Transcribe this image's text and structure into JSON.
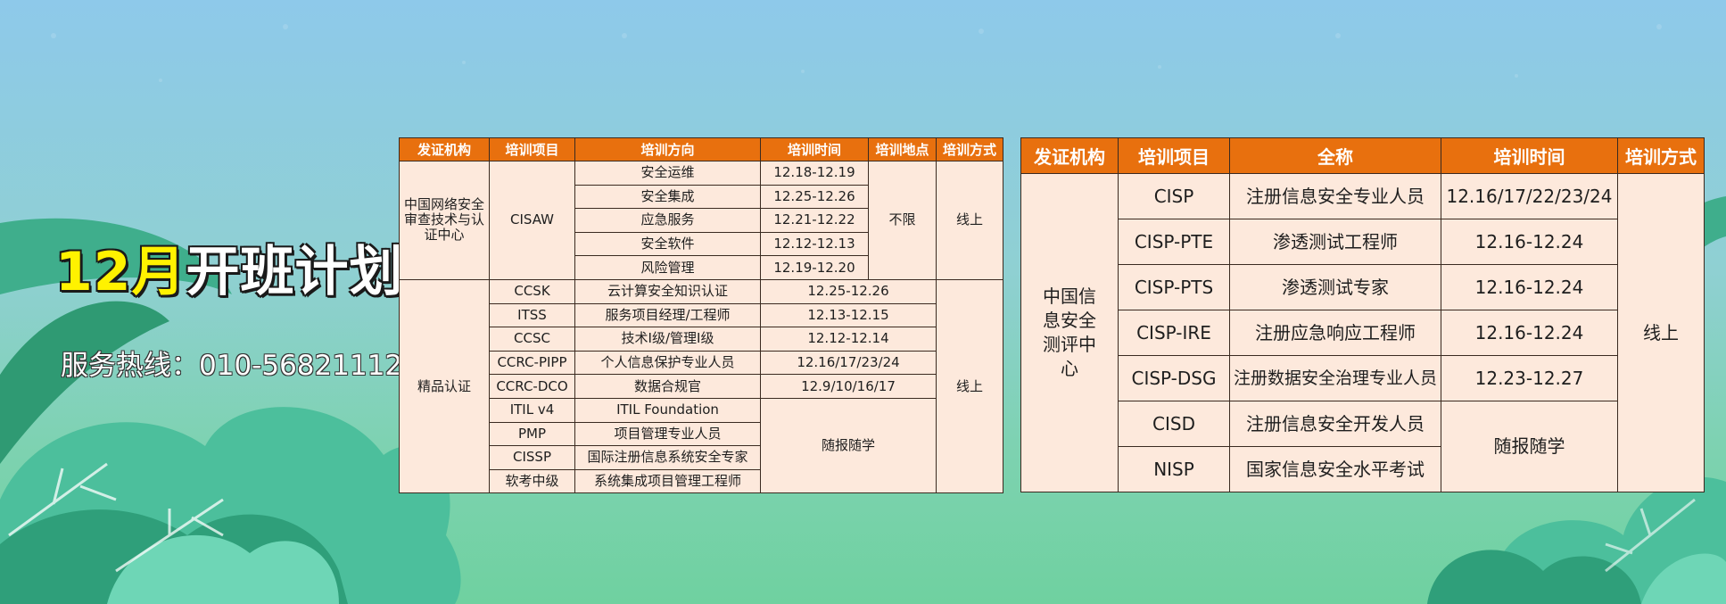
{
  "theme": {
    "accent": "#e8700e",
    "cell_bg": "#fde9dc",
    "headline_highlight": "#fff200"
  },
  "headline": {
    "part1": "12月",
    "part2": "开班计划"
  },
  "hotline": {
    "text": "服务热线：010-56821112"
  },
  "table1": {
    "headers": [
      "发证机构",
      "培训项目",
      "培训方向",
      "培训时间",
      "培训地点",
      "培训方式"
    ],
    "cisaw": {
      "org": "中国网络安全审查技术与认证中心",
      "project": "CISAW",
      "location": "不限",
      "method": "线上",
      "rows": [
        {
          "direction": "安全运维",
          "time": "12.18-12.19"
        },
        {
          "direction": "安全集成",
          "time": "12.25-12.26"
        },
        {
          "direction": "应急服务",
          "time": "12.21-12.22"
        },
        {
          "direction": "安全软件",
          "time": "12.12-12.13"
        },
        {
          "direction": "风险管理",
          "time": "12.19-12.20"
        }
      ]
    },
    "premium": {
      "org": "精品认证",
      "method": "线上",
      "flex_label": "随报随学",
      "rows": [
        {
          "project": "CCSK",
          "direction": "云计算安全知识认证",
          "time": "12.25-12.26"
        },
        {
          "project": "ITSS",
          "direction": "服务项目经理/工程师",
          "time": "12.13-12.15"
        },
        {
          "project": "CCSC",
          "direction": "技术Ⅰ级/管理Ⅰ级",
          "time": "12.12-12.14"
        },
        {
          "project": "CCRC-PIPP",
          "direction": "个人信息保护专业人员",
          "time": "12.16/17/23/24"
        },
        {
          "project": "CCRC-DCO",
          "direction": "数据合规官",
          "time": "12.9/10/16/17"
        },
        {
          "project": "ITIL v4",
          "direction": "ITIL Foundation"
        },
        {
          "project": "PMP",
          "direction": "项目管理专业人员"
        },
        {
          "project": "CISSP",
          "direction": "国际注册信息系统安全专家"
        },
        {
          "project": "软考中级",
          "direction": "系统集成项目管理工程师"
        }
      ]
    }
  },
  "table2": {
    "headers": [
      "发证机构",
      "培训项目",
      "全称",
      "培训时间",
      "培训方式"
    ],
    "org": "中国信息安全测评中心",
    "method": "线上",
    "flex_label": "随报随学",
    "rows": [
      {
        "project": "CISP",
        "fullname": "注册信息安全专业人员",
        "time": "12.16/17/22/23/24"
      },
      {
        "project": "CISP-PTE",
        "fullname": "渗透测试工程师",
        "time": "12.16-12.24"
      },
      {
        "project": "CISP-PTS",
        "fullname": "渗透测试专家",
        "time": "12.16-12.24"
      },
      {
        "project": "CISP-IRE",
        "fullname": "注册应急响应工程师",
        "time": "12.16-12.24"
      },
      {
        "project": "CISP-DSG",
        "fullname": "注册数据安全治理专业人员",
        "time": "12.23-12.27"
      },
      {
        "project": "CISD",
        "fullname": "注册信息安全开发人员"
      },
      {
        "project": "NISP",
        "fullname": "国家信息安全水平考试"
      }
    ]
  }
}
